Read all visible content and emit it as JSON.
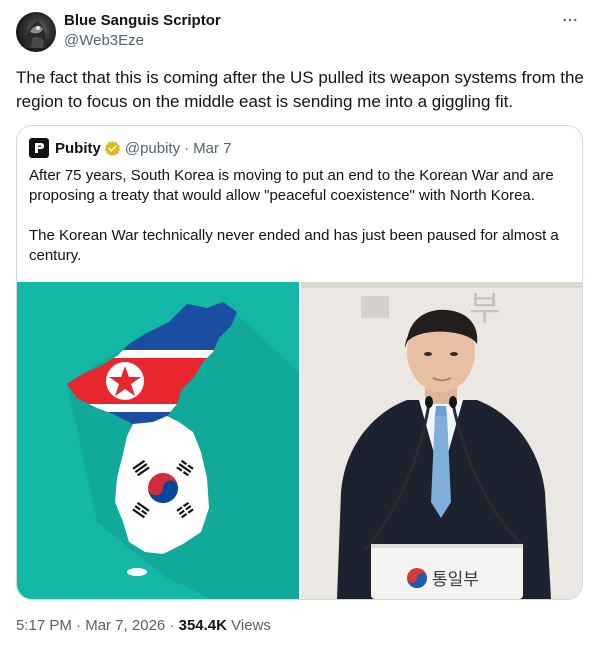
{
  "author": {
    "name": "Blue Sanguis Scriptor",
    "handle": "@Web3Eze"
  },
  "tweet": {
    "text": "The fact that this is coming after the US pulled its weapon systems from the region to focus on the middle east is sending me into a giggling fit."
  },
  "quoted": {
    "name": "Pubity",
    "handle": "@pubity",
    "separator": "·",
    "date": "Mar 7",
    "paragraph1": "After 75 years, South Korea is moving to put an end to the Korean War and are proposing a treaty that would allow \"peaceful coexistence\" with North Korea.",
    "paragraph2": "The Korean War technically never ended and has just been paused for almost a century.",
    "podium_text": "통일부",
    "wall_text": "부"
  },
  "footer": {
    "time": "5:17 PM",
    "separator1": "·",
    "date": "Mar 7, 2026",
    "separator2": "·",
    "views_count": "354.4K",
    "views_label": "Views"
  },
  "colors": {
    "verified_gold": "#e2b719",
    "map_background": "#12b7a6",
    "nk_red": "#e8262d",
    "nk_blue": "#1b4ea2",
    "sk_red": "#cd2e3a",
    "sk_blue": "#0047a0"
  },
  "icons": [
    "more-icon",
    "verified-badge-icon",
    "pubity-logo-icon"
  ]
}
